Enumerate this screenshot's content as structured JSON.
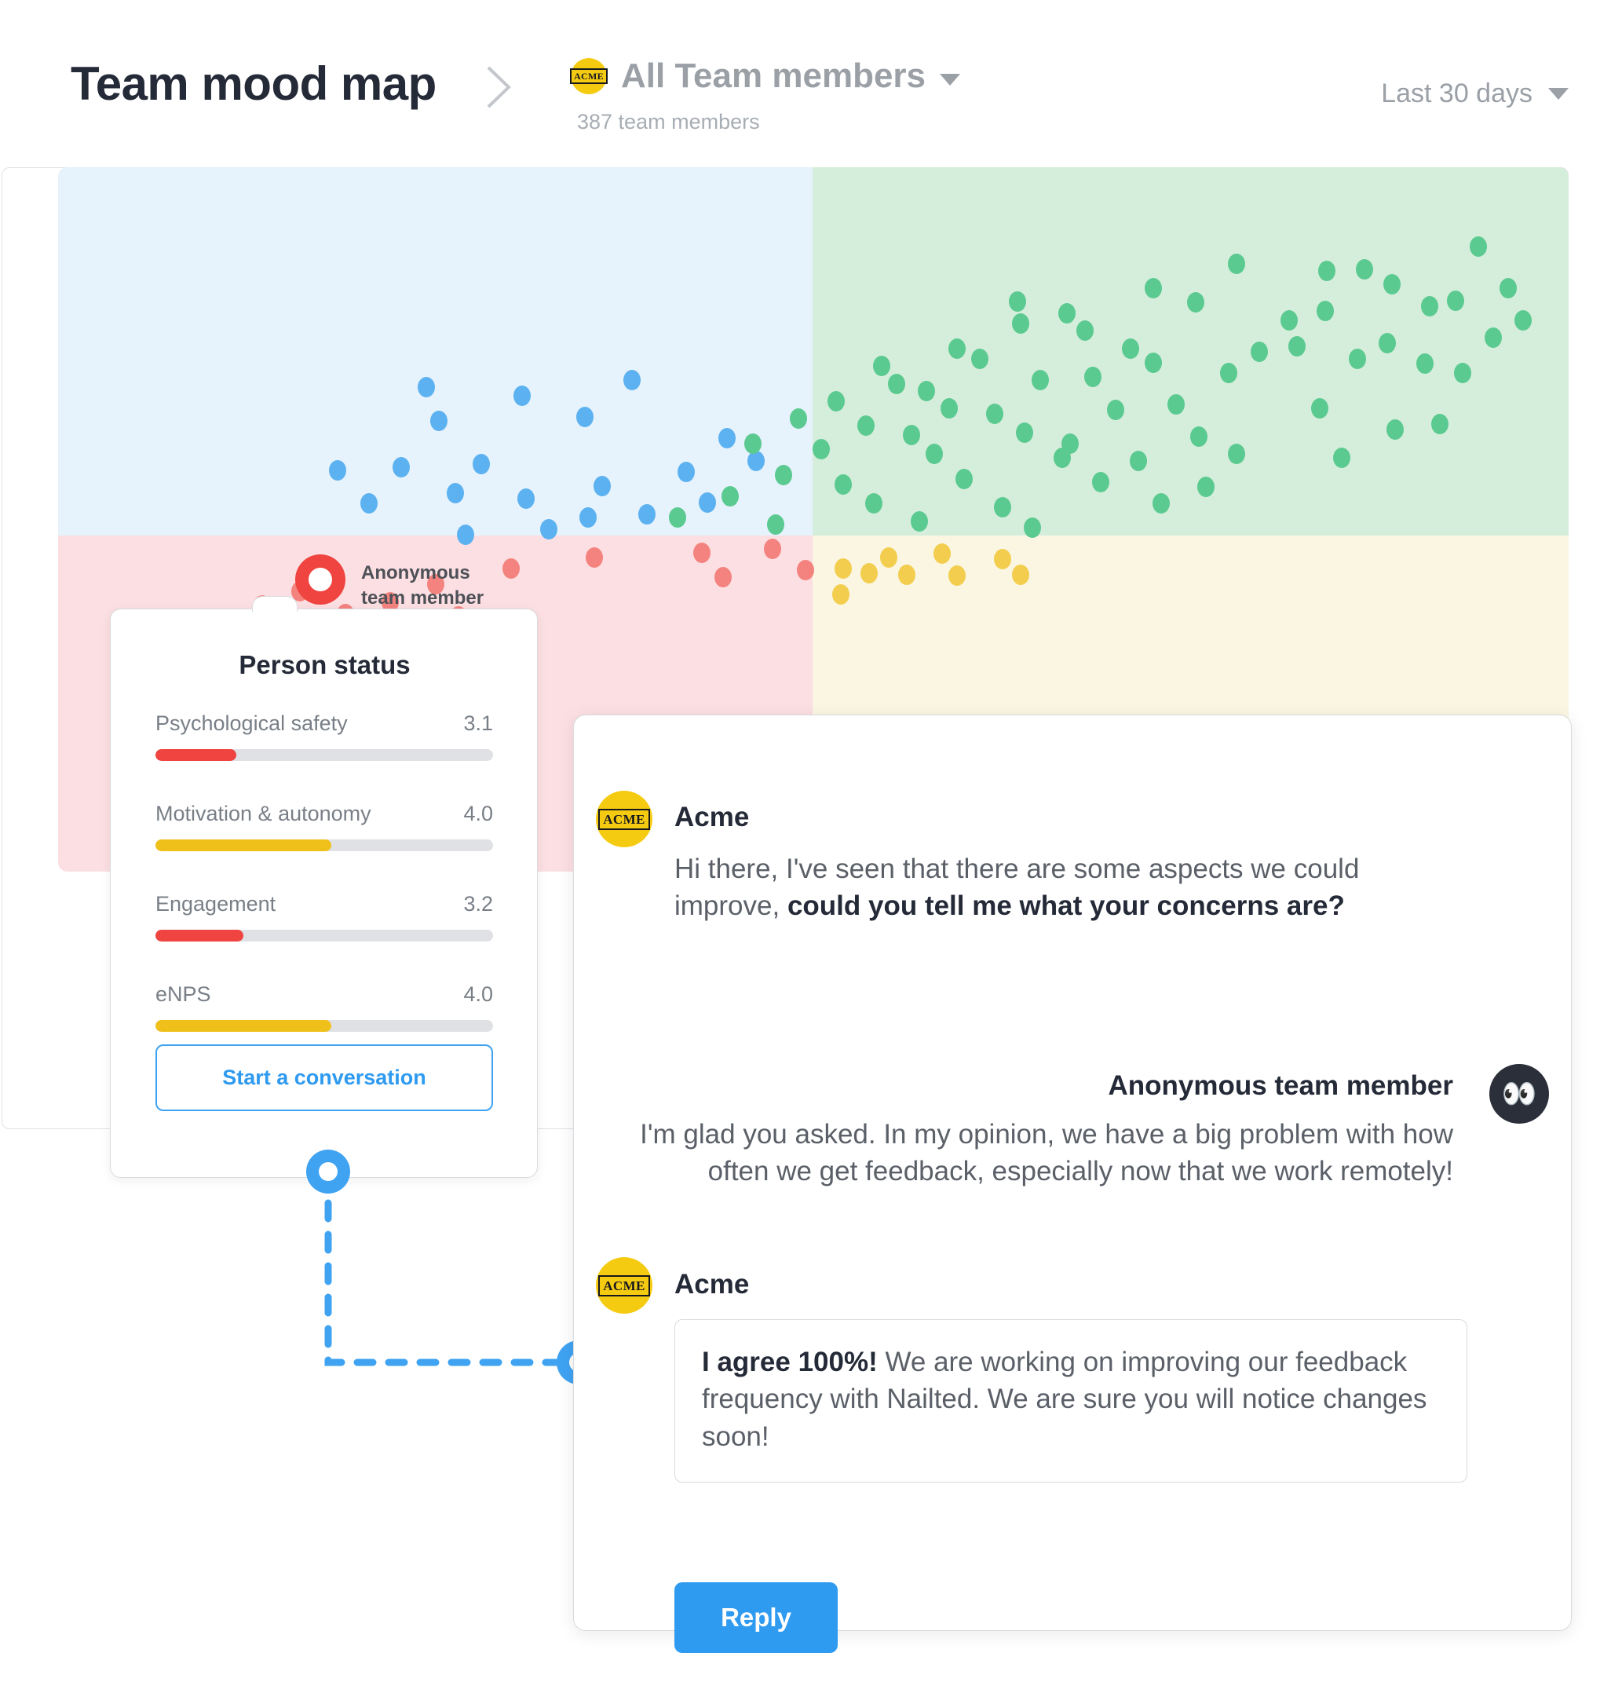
{
  "header": {
    "page_title": "Team mood map",
    "breadcrumb_separator_icon": "chevron-right-icon",
    "team": {
      "avatar_icon": "acme-logo-icon",
      "avatar_text": "ACME",
      "name": "All Team members",
      "caret_icon": "chevron-down-icon",
      "member_count_label": "387 team members"
    },
    "date_range": {
      "label": "Last 30 days",
      "caret_icon": "chevron-down-icon"
    }
  },
  "mood_map": {
    "marker": {
      "icon": "person-pin-icon",
      "label": "Anonymous team member"
    }
  },
  "person_status": {
    "title": "Person status",
    "metrics": [
      {
        "name": "Psychological safety",
        "value": "3.1",
        "pct": 24,
        "color": "#ef4440"
      },
      {
        "name": "Motivation & autonomy",
        "value": "4.0",
        "pct": 52,
        "color": "#f0c01a"
      },
      {
        "name": "Engagement",
        "value": "3.2",
        "pct": 26,
        "color": "#ef4440"
      },
      {
        "name": "eNPS",
        "value": "4.0",
        "pct": 52,
        "color": "#f0c01a"
      }
    ],
    "start_conversation_label": "Start a conversation"
  },
  "chat": {
    "messages": [
      {
        "sender": "Acme",
        "avatar_icon": "acme-logo-icon",
        "avatar_text": "ACME",
        "text_plain": "Hi there, I've seen that there are some aspects we could improve, ",
        "text_bold": "could you tell me what your concerns are?"
      },
      {
        "sender": "Anonymous team member",
        "avatar_icon": "eyes-emoji-icon",
        "avatar_text": "👀",
        "text_plain": "I'm glad you asked. In my opinion, we have a big problem with how often we get feedback, especially now that we work remotely!"
      },
      {
        "sender": "Acme",
        "avatar_icon": "acme-logo-icon",
        "avatar_text": "ACME",
        "text_bold": "I agree 100%!",
        "text_plain": " We are working on improving our feedback frequency with Nailted. We are sure you will notice changes soon!"
      }
    ],
    "reply_button_label": "Reply"
  },
  "colors": {
    "accent_blue": "#2e9af0",
    "quadrant_top_left": "#e6f2fc",
    "quadrant_top_right": "#d5eedb",
    "quadrant_bottom_left": "#fcdfe2",
    "quadrant_bottom_right": "#faf6e2",
    "dot_blue": "#5cb2f0",
    "dot_green": "#5bca91",
    "dot_red": "#f4837f",
    "dot_yellow": "#f3ce4e",
    "brand_yellow": "#f5cb12"
  },
  "chart_data": {
    "type": "scatter",
    "title": "Team mood map",
    "xlabel": "",
    "ylabel": "",
    "grid": false,
    "legend": "none",
    "xlim": [
      0,
      100
    ],
    "ylim": [
      0,
      100
    ],
    "quadrants": [
      {
        "name": "top-left",
        "color": "#e6f2fc",
        "dot_color": "#5cb2f0",
        "x_range": [
          0,
          50
        ],
        "y_range": [
          47.7,
          100
        ]
      },
      {
        "name": "top-right",
        "color": "#d5eedb",
        "dot_color": "#5bca91",
        "x_range": [
          50,
          100
        ],
        "y_range": [
          47.7,
          100
        ]
      },
      {
        "name": "bottom-left",
        "color": "#fcdfe2",
        "dot_color": "#f4837f",
        "x_range": [
          0,
          50
        ],
        "y_range": [
          0,
          47.7
        ]
      },
      {
        "name": "bottom-right",
        "color": "#faf6e2",
        "dot_color": "#f3ce4e",
        "x_range": [
          50,
          100
        ],
        "y_range": [
          0,
          47.7
        ]
      }
    ],
    "series": [
      {
        "name": "Blue cluster",
        "color": "#5cb2f0",
        "points": [
          [
            24.4,
            69.0
          ],
          [
            25.2,
            64.2
          ],
          [
            30.7,
            67.8
          ],
          [
            34.9,
            64.8
          ],
          [
            38.0,
            70.0
          ],
          [
            22.7,
            57.6
          ],
          [
            28.0,
            58.1
          ],
          [
            18.5,
            57.2
          ],
          [
            26.3,
            54.0
          ],
          [
            20.6,
            52.5
          ],
          [
            31.0,
            53.2
          ],
          [
            36.0,
            55.0
          ],
          [
            41.6,
            57.0
          ],
          [
            44.3,
            61.8
          ],
          [
            46.2,
            58.5
          ],
          [
            35.1,
            50.5
          ],
          [
            39.0,
            51.0
          ],
          [
            43.0,
            52.6
          ],
          [
            32.5,
            48.8
          ],
          [
            27.0,
            48.0
          ]
        ]
      },
      {
        "name": "Green cluster",
        "color": "#5bca91",
        "points": [
          [
            94.0,
            89.0
          ],
          [
            78.0,
            86.5
          ],
          [
            84.0,
            85.5
          ],
          [
            86.5,
            85.7
          ],
          [
            88.3,
            83.6
          ],
          [
            72.5,
            83.0
          ],
          [
            75.3,
            81.0
          ],
          [
            63.5,
            81.2
          ],
          [
            63.7,
            78.0
          ],
          [
            66.8,
            79.5
          ],
          [
            68.0,
            77.0
          ],
          [
            81.5,
            78.5
          ],
          [
            83.9,
            79.8
          ],
          [
            90.8,
            80.5
          ],
          [
            92.5,
            81.3
          ],
          [
            96.0,
            83.0
          ],
          [
            97.0,
            78.5
          ],
          [
            95.0,
            76.0
          ],
          [
            59.5,
            74.5
          ],
          [
            61.0,
            73.0
          ],
          [
            71.0,
            74.5
          ],
          [
            72.5,
            72.5
          ],
          [
            79.5,
            74.0
          ],
          [
            82.0,
            74.8
          ],
          [
            86.0,
            73.0
          ],
          [
            88.0,
            75.2
          ],
          [
            54.5,
            72.0
          ],
          [
            55.5,
            69.5
          ],
          [
            57.5,
            68.4
          ],
          [
            65.0,
            70.0
          ],
          [
            68.5,
            70.5
          ],
          [
            77.5,
            71.0
          ],
          [
            90.5,
            72.4
          ],
          [
            93.0,
            71.0
          ],
          [
            51.5,
            67.0
          ],
          [
            59.0,
            66.0
          ],
          [
            62.0,
            65.2
          ],
          [
            70.0,
            65.8
          ],
          [
            74.0,
            66.5
          ],
          [
            83.5,
            66.0
          ],
          [
            49.0,
            64.5
          ],
          [
            53.5,
            63.6
          ],
          [
            56.5,
            62.2
          ],
          [
            64.0,
            62.5
          ],
          [
            67.0,
            61.0
          ],
          [
            75.5,
            62.0
          ],
          [
            88.5,
            63.0
          ],
          [
            91.5,
            63.8
          ],
          [
            46.0,
            61.0
          ],
          [
            50.5,
            60.2
          ],
          [
            58.0,
            59.5
          ],
          [
            66.5,
            59.0
          ],
          [
            71.5,
            58.5
          ],
          [
            78.0,
            59.5
          ],
          [
            85.0,
            59.0
          ],
          [
            48.0,
            56.5
          ],
          [
            52.0,
            55.2
          ],
          [
            60.0,
            56.0
          ],
          [
            69.0,
            55.5
          ],
          [
            76.0,
            54.8
          ],
          [
            44.5,
            53.5
          ],
          [
            54.0,
            52.5
          ],
          [
            62.5,
            52.0
          ],
          [
            73.0,
            52.5
          ],
          [
            41.0,
            50.5
          ],
          [
            47.5,
            49.5
          ],
          [
            57.0,
            50.0
          ],
          [
            64.5,
            49.0
          ]
        ]
      },
      {
        "name": "Red cluster",
        "color": "#f4837f",
        "points": [
          [
            35.5,
            44.8
          ],
          [
            42.6,
            45.5
          ],
          [
            47.3,
            46.0
          ],
          [
            49.5,
            43.0
          ],
          [
            44.0,
            42.0
          ],
          [
            30.0,
            43.2
          ],
          [
            25.0,
            41.0
          ],
          [
            22.0,
            38.5
          ],
          [
            26.5,
            36.5
          ],
          [
            30.2,
            36.0
          ],
          [
            19.0,
            36.8
          ],
          [
            16.0,
            40.0
          ],
          [
            13.5,
            38.0
          ]
        ]
      },
      {
        "name": "Yellow cluster",
        "color": "#f3ce4e",
        "points": [
          [
            55.0,
            44.8
          ],
          [
            58.5,
            45.4
          ],
          [
            62.5,
            44.6
          ],
          [
            52.0,
            43.2
          ],
          [
            53.7,
            42.6
          ],
          [
            56.2,
            42.4
          ],
          [
            59.5,
            42.2
          ],
          [
            63.7,
            42.4
          ],
          [
            51.8,
            39.6
          ]
        ]
      }
    ]
  }
}
